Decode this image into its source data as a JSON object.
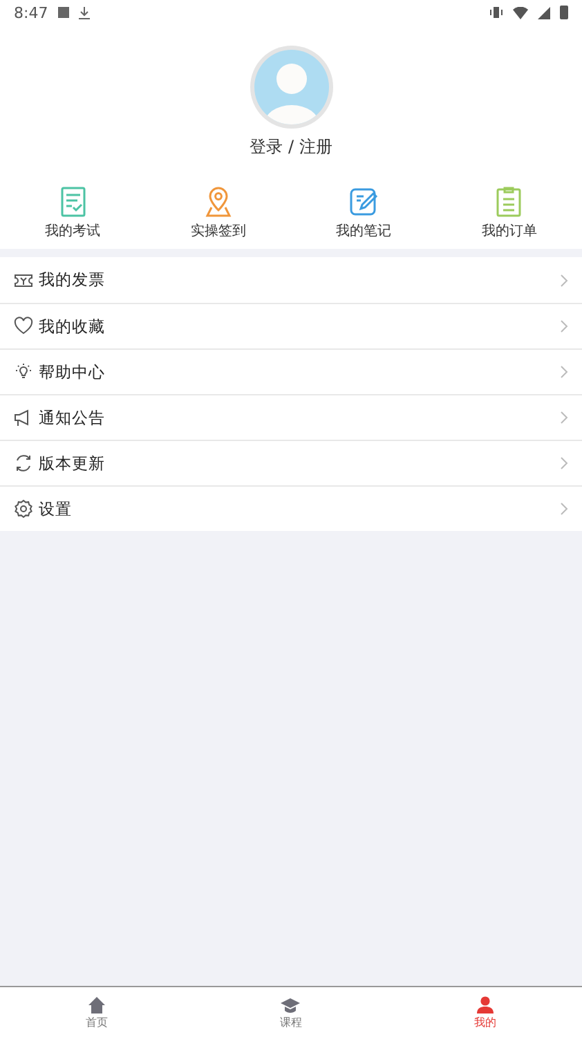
{
  "status_bar": {
    "time": "8:47"
  },
  "profile": {
    "login_label": "登录 / 注册"
  },
  "shortcuts": [
    {
      "kind": "exam",
      "label": "我的考试"
    },
    {
      "kind": "checkin",
      "label": "实操签到"
    },
    {
      "kind": "notes",
      "label": "我的笔记"
    },
    {
      "kind": "orders",
      "label": "我的订单"
    }
  ],
  "menu": [
    {
      "kind": "invoice",
      "label": "我的发票"
    },
    {
      "kind": "favorites",
      "label": "我的收藏"
    },
    {
      "kind": "help",
      "label": "帮助中心"
    },
    {
      "kind": "notice",
      "label": "通知公告"
    },
    {
      "kind": "update",
      "label": "版本更新"
    },
    {
      "kind": "settings",
      "label": "设置"
    }
  ],
  "tab_bar": [
    {
      "kind": "home",
      "label": "首页",
      "selected": false
    },
    {
      "kind": "courses",
      "label": "课程",
      "selected": false
    },
    {
      "kind": "mine",
      "label": "我的",
      "selected": true
    }
  ]
}
